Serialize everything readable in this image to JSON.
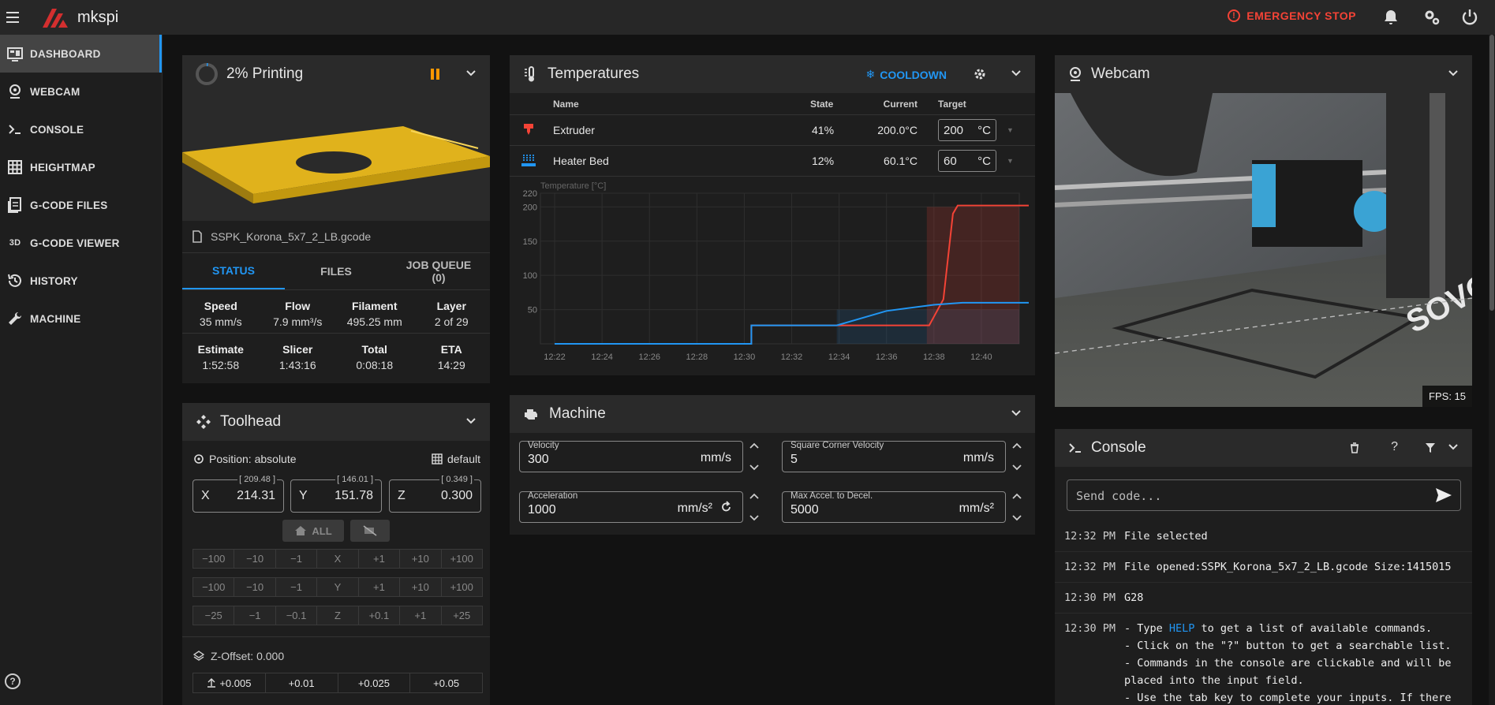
{
  "app": {
    "brand": "mkspi",
    "emergency_stop": "EMERGENCY STOP"
  },
  "sidebar": {
    "items": [
      {
        "label": "DASHBOARD",
        "icon": "monitor-dashboard-icon",
        "active": true
      },
      {
        "label": "WEBCAM",
        "icon": "webcam-icon"
      },
      {
        "label": "CONSOLE",
        "icon": "console-icon"
      },
      {
        "label": "HEIGHTMAP",
        "icon": "grid-icon"
      },
      {
        "label": "G-CODE FILES",
        "icon": "files-icon"
      },
      {
        "label": "G-CODE VIEWER",
        "icon": "3d-icon",
        "prefix": "3D"
      },
      {
        "label": "HISTORY",
        "icon": "history-icon"
      },
      {
        "label": "MACHINE",
        "icon": "wrench-icon"
      }
    ]
  },
  "status": {
    "title": "2% Printing",
    "progress": 0.02,
    "filename": "SSPK_Korona_5x7_2_LB.gcode",
    "tabs": [
      "STATUS",
      "FILES",
      "JOB QUEUE\n(0)"
    ],
    "row1": [
      {
        "h": "Speed",
        "v": "35 mm/s"
      },
      {
        "h": "Flow",
        "v": "7.9 mm³/s"
      },
      {
        "h": "Filament",
        "v": "495.25 mm"
      },
      {
        "h": "Layer",
        "v": "2 of 29"
      }
    ],
    "row2": [
      {
        "h": "Estimate",
        "v": "1:52:58"
      },
      {
        "h": "Slicer",
        "v": "1:43:16"
      },
      {
        "h": "Total",
        "v": "0:08:18"
      },
      {
        "h": "ETA",
        "v": "14:29"
      }
    ]
  },
  "toolhead": {
    "title": "Toolhead",
    "position_label": "Position: absolute",
    "grid_label": "default",
    "axes": [
      {
        "axis": "X",
        "value": "214.31",
        "target": "[ 209.48 ]"
      },
      {
        "axis": "Y",
        "value": "151.78",
        "target": "[ 146.01 ]"
      },
      {
        "axis": "Z",
        "value": "0.300",
        "target": "[ 0.349 ]"
      }
    ],
    "home_all": "ALL",
    "jog_x": [
      "−100",
      "−10",
      "−1",
      "X",
      "+1",
      "+10",
      "+100"
    ],
    "jog_y": [
      "−100",
      "−10",
      "−1",
      "Y",
      "+1",
      "+10",
      "+100"
    ],
    "jog_z": [
      "−25",
      "−1",
      "−0.1",
      "Z",
      "+0.1",
      "+1",
      "+25"
    ],
    "zoffset_label": "Z-Offset: 0.000",
    "zoffset_buttons": [
      "+0.005",
      "+0.01",
      "+0.025",
      "+0.05"
    ]
  },
  "temperatures": {
    "title": "Temperatures",
    "cooldown": "COOLDOWN",
    "headers": {
      "name": "Name",
      "state": "State",
      "current": "Current",
      "target": "Target"
    },
    "rows": [
      {
        "name": "Extruder",
        "state": "41%",
        "current": "200.0°C",
        "target": "200",
        "unit": "°C",
        "color": "#f44336"
      },
      {
        "name": "Heater Bed",
        "state": "12%",
        "current": "60.1°C",
        "target": "60",
        "unit": "°C",
        "color": "#2196f3"
      }
    ]
  },
  "chart_data": {
    "type": "line",
    "ylabel": "Temperature [°C]",
    "ylim": [
      0,
      220
    ],
    "yticks": [
      50,
      100,
      150,
      200,
      220
    ],
    "x": [
      "12:22",
      "12:24",
      "12:26",
      "12:28",
      "12:30",
      "12:32",
      "12:34",
      "12:36",
      "12:38",
      "12:40"
    ],
    "series": [
      {
        "name": "Extruder",
        "color": "#f44336",
        "points": [
          [
            0,
            0
          ],
          [
            4.15,
            0
          ],
          [
            4.15,
            27
          ],
          [
            7.9,
            27
          ],
          [
            8.2,
            65
          ],
          [
            8.4,
            190
          ],
          [
            8.5,
            202
          ],
          [
            8.7,
            202
          ],
          [
            10,
            202
          ]
        ]
      },
      {
        "name": "Heater Bed",
        "color": "#2196f3",
        "points": [
          [
            0,
            0
          ],
          [
            4.15,
            0
          ],
          [
            4.15,
            27
          ],
          [
            5.95,
            27
          ],
          [
            7.0,
            48
          ],
          [
            8.0,
            57
          ],
          [
            8.6,
            60
          ],
          [
            10,
            60
          ]
        ]
      }
    ]
  },
  "machine": {
    "title": "Machine",
    "fields": [
      {
        "label": "Velocity",
        "value": "300",
        "unit": "mm/s"
      },
      {
        "label": "Square Corner Velocity",
        "value": "5",
        "unit": "mm/s"
      },
      {
        "label": "Acceleration",
        "value": "1000",
        "unit": "mm/s²"
      },
      {
        "label": "Max Accel. to Decel.",
        "value": "5000",
        "unit": "mm/s²"
      }
    ]
  },
  "webcam": {
    "title": "Webcam",
    "fps": "FPS: 15"
  },
  "console": {
    "title": "Console",
    "placeholder": "Send code...",
    "lines": [
      {
        "time": "12:32 PM",
        "msg": "File selected"
      },
      {
        "time": "12:32 PM",
        "msg": "File opened:SSPK_Korona_5x7_2_LB.gcode Size:1415015"
      },
      {
        "time": "12:30 PM",
        "msg": "G28",
        "cmd": true
      },
      {
        "time": "12:30 PM",
        "pre": "- Type ",
        "help": "HELP",
        "msg": " to get a list of available commands.\n- Click on the \"?\" button to get a searchable list.\n- Commands in the console are clickable and will be\nplaced into the input field.\n- Use the tab key to complete your inputs. If there"
      }
    ]
  }
}
